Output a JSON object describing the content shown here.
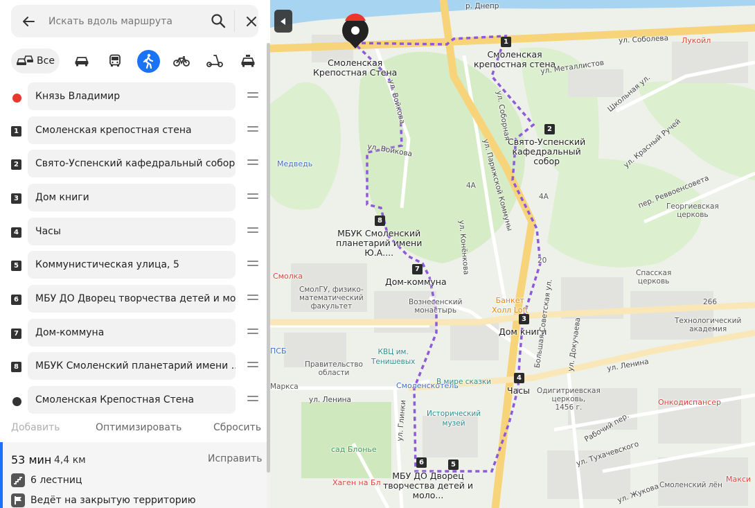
{
  "search": {
    "placeholder": "Искать вдоль маршрута"
  },
  "modes": {
    "all_label": "Все",
    "active": "walk"
  },
  "stops": [
    {
      "marker": "start",
      "label": "Князь Владимир"
    },
    {
      "marker": "1",
      "label": "Смоленская крепостная стена"
    },
    {
      "marker": "2",
      "label": "Свято-Успенский кафедральный собор"
    },
    {
      "marker": "3",
      "label": "Дом книги"
    },
    {
      "marker": "4",
      "label": "Часы"
    },
    {
      "marker": "5",
      "label": "Коммунистическая улица, 5"
    },
    {
      "marker": "6",
      "label": "МБУ ДО Дворец творчества детей и мо..."
    },
    {
      "marker": "7",
      "label": "Дом-коммуна"
    },
    {
      "marker": "8",
      "label": "МБУК Смоленский планетарий имени ..."
    },
    {
      "marker": "end",
      "label": "Смоленская Крепостная Стена"
    }
  ],
  "actions": {
    "add": "Добавить",
    "optimize": "Оптимизировать",
    "reset": "Сбросить"
  },
  "summary": {
    "time": "53 мин",
    "distance": "4,4 км",
    "fix": "Исправить",
    "notes": [
      "6 лестниц",
      "Ведёт на закрытую территорию"
    ]
  },
  "colors": {
    "accent": "#1a73f5",
    "start": "#e8372d",
    "route": "#8e5bd8",
    "map_bg": "#eef0ea",
    "park": "#d6ecc6",
    "road_main": "#f7d37a"
  },
  "map": {
    "route_labels": {
      "1": [
        "Смоленская",
        "крепостная стена"
      ],
      "2": [
        "Свято-Успенский",
        "кафедральный",
        "собор"
      ],
      "3": [
        "Дом книги"
      ],
      "4": [
        "Часы"
      ],
      "6": [
        "МБУ ДО Дворец",
        "творчества детей и",
        "моло..."
      ],
      "7": [
        "Дом-коммуна"
      ],
      "8": [
        "МБУК Смоленский",
        "планетарий имени",
        "Ю.А...."
      ],
      "end": [
        "Смоленская",
        "Крепостная Стена"
      ]
    },
    "streets": {
      "dnepr": "р. Днепр",
      "soboleva": "ул. Соболева",
      "metallistov": "ул. Металлистов",
      "shkolnaya": "Школьная ул.",
      "krasny": "ул. Красный Ручей",
      "revvoensoveta": "пер. Реввоенсовета",
      "lenina_e": "ул. Ленина",
      "lenina_w": "ул. Ленина",
      "bsovetskaya": "Большая Советская ул.",
      "dokuchaeva": "ул. Докучаева",
      "tukhachevskogo": "ул. Тухачевского",
      "rabochy": "Рабочий пер.",
      "glinki": "ул. Глинки",
      "voykova": "ул. Войкова",
      "voykova2": "ул. Войкова",
      "konenkova": "ул. Конёнкова",
      "parizhskoy": "ул. Парижской Коммуны",
      "sobornaya": "ул. Соборная",
      "zhukova": "ул. Жукова"
    },
    "places": {
      "medved": "Медведь",
      "smolka": "Смолка",
      "psb": "ПСБ",
      "lukoil": "Лукойл",
      "smolgu": [
        "СмолГУ, физико-",
        "математический",
        "факультет"
      ],
      "voznesensky": [
        "Вознесенский",
        "монастырь"
      ],
      "kvc": [
        "КВЦ им.",
        "Тенишевых"
      ],
      "pravitelstvo": [
        "Правительство",
        "области"
      ],
      "smolenskotel": "Смоленскотель",
      "vmireskazki": "В мире сказки",
      "istmuzei": [
        "Исторический",
        "музей"
      ],
      "sadblonye": "сад Блонье",
      "khagen": "Хаген на Бл",
      "markса": "Маркса",
      "banket": [
        "Банкет",
        "Холл Loft"
      ],
      "georgievskaya": [
        "Георгиевская",
        "церковь"
      ],
      "spasskaya": [
        "Спасская",
        "церковь"
      ],
      "technological": [
        "Технологический",
        "академия"
      ],
      "odigitrievskaya": [
        "Одигитриевская",
        "церковь,",
        "1456 г."
      ],
      "onkodispanser": "Онкодиспансер",
      "maksi": "Макси",
      "smolensky_len": "Смоленский лён",
      "num_266": "266",
      "num_4a": "4А",
      "num_4a2": "4А",
      "num_20": "20"
    }
  }
}
